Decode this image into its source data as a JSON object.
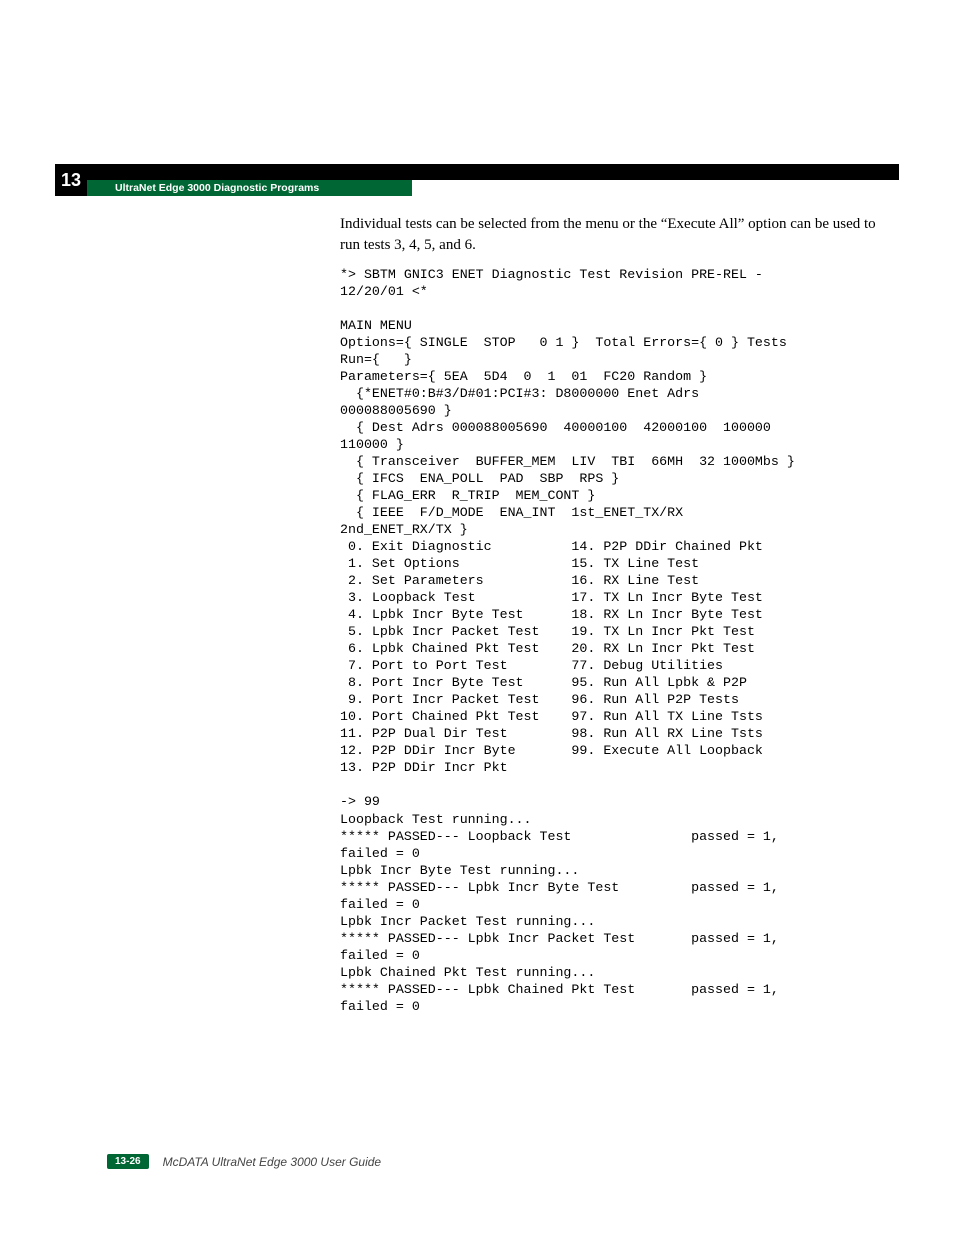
{
  "chapter_number": "13",
  "header_title": "UltraNet Edge 3000 Diagnostic Programs",
  "intro_text": "Individual tests can be selected from the menu or the “Execute All” option can be used to run tests 3, 4, 5, and 6.",
  "terminal": "*> SBTM GNIC3 ENET Diagnostic Test Revision PRE-REL -\n12/20/01 <*\n\nMAIN MENU\nOptions={ SINGLE  STOP   0 1 }  Total Errors={ 0 } Tests\nRun={   }\nParameters={ 5EA  5D4  0  1  01  FC20 Random }\n  {*ENET#0:B#3/D#01:PCI#3: D8000000 Enet Adrs\n000088005690 }\n  { Dest Adrs 000088005690  40000100  42000100  100000\n110000 }\n  { Transceiver  BUFFER_MEM  LIV  TBI  66MH  32 1000Mbs }\n  { IFCS  ENA_POLL  PAD  SBP  RPS }\n  { FLAG_ERR  R_TRIP  MEM_CONT }\n  { IEEE  F/D_MODE  ENA_INT  1st_ENET_TX/RX\n2nd_ENET_RX/TX }\n 0. Exit Diagnostic          14. P2P DDir Chained Pkt\n 1. Set Options              15. TX Line Test\n 2. Set Parameters           16. RX Line Test\n 3. Loopback Test            17. TX Ln Incr Byte Test\n 4. Lpbk Incr Byte Test      18. RX Ln Incr Byte Test\n 5. Lpbk Incr Packet Test    19. TX Ln Incr Pkt Test\n 6. Lpbk Chained Pkt Test    20. RX Ln Incr Pkt Test\n 7. Port to Port Test        77. Debug Utilities\n 8. Port Incr Byte Test      95. Run All Lpbk & P2P\n 9. Port Incr Packet Test    96. Run All P2P Tests\n10. Port Chained Pkt Test    97. Run All TX Line Tsts\n11. P2P Dual Dir Test        98. Run All RX Line Tsts\n12. P2P DDir Incr Byte       99. Execute All Loopback\n13. P2P DDir Incr Pkt\n\n-> 99\nLoopback Test running...\n***** PASSED--- Loopback Test               passed = 1,\nfailed = 0\nLpbk Incr Byte Test running...\n***** PASSED--- Lpbk Incr Byte Test         passed = 1,\nfailed = 0\nLpbk Incr Packet Test running...\n***** PASSED--- Lpbk Incr Packet Test       passed = 1,\nfailed = 0\nLpbk Chained Pkt Test running...\n***** PASSED--- Lpbk Chained Pkt Test       passed = 1,\nfailed = 0",
  "page_number": "13-26",
  "footer_title": "McDATA UltraNet Edge 3000 User Guide"
}
